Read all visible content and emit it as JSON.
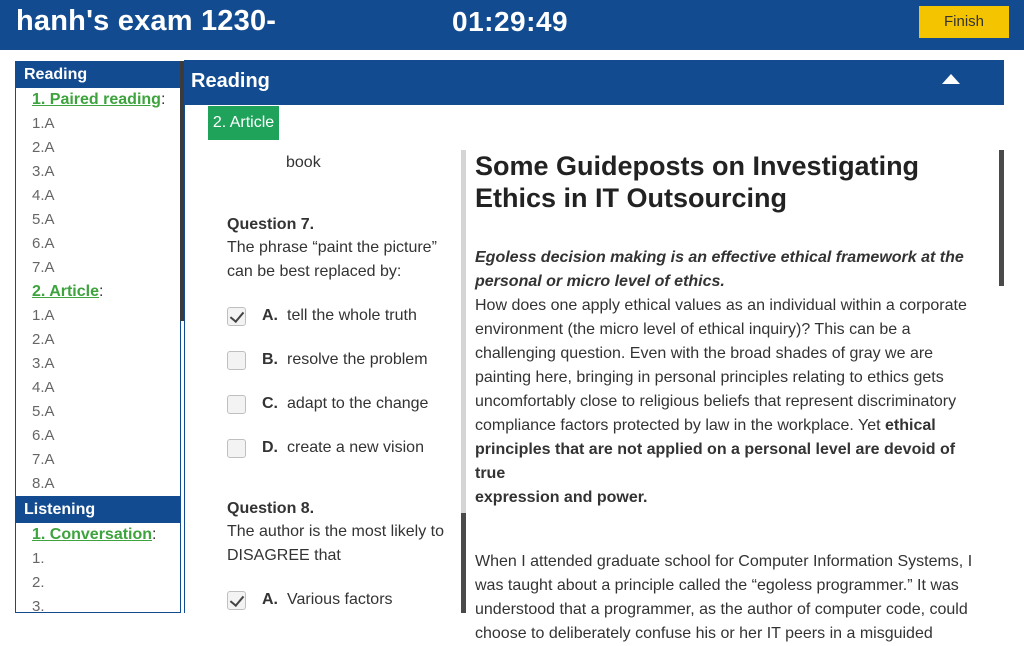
{
  "header": {
    "exam_title": "hanh's exam 1230-",
    "timer": "01:29:49",
    "finish_label": "Finish"
  },
  "sidebar": {
    "reading_heading": "Reading",
    "part1": {
      "label": "1. Paired reading",
      "items": [
        "1.A",
        "2.A",
        "3.A",
        "4.A",
        "5.A",
        "6.A",
        "7.A"
      ]
    },
    "part2": {
      "label": "2. Article",
      "items": [
        "1.A",
        "2.A",
        "3.A",
        "4.A",
        "5.A",
        "6.A",
        "7.A",
        "8.A"
      ]
    },
    "listening_heading": "Listening",
    "part3": {
      "label": "1. Conversation",
      "items": [
        "1.",
        "2.",
        "3."
      ]
    }
  },
  "panel": {
    "heading": "Reading",
    "active_tab": "2. Article"
  },
  "questions": {
    "fragment": "book",
    "q7": {
      "title": "Question 7.",
      "text_line1": "The phrase “paint the picture”",
      "text_line2": "can be best replaced by:",
      "options": [
        {
          "letter": "A.",
          "text": "tell the whole truth",
          "checked": true
        },
        {
          "letter": "B.",
          "text": "resolve the problem",
          "checked": false
        },
        {
          "letter": "C.",
          "text": "adapt to the change",
          "checked": false
        },
        {
          "letter": "D.",
          "text": "create a new vision",
          "checked": false
        }
      ]
    },
    "q8": {
      "title": "Question 8.",
      "text_line1": "The author is the most likely to",
      "text_line2": "DISAGREE that",
      "options": [
        {
          "letter": "A.",
          "text": "Various factors",
          "checked": true
        }
      ]
    }
  },
  "article": {
    "title_line1": "Some Guideposts on Investigating",
    "title_line2": "Ethics in IT Outsourcing",
    "lead_line1": "Egoless decision making is an effective ethical framework at the",
    "lead_line2": "personal or micro level of ethics.",
    "p1_lines": [
      "How does one apply ethical values as an individual within a corporate",
      "environment (the micro level of ethical inquiry)? This can be a",
      "challenging question. Even with the broad shades of gray we are",
      "painting here, bringing in personal principles relating to ethics gets",
      "uncomfortably close to religious beliefs that represent discriminatory"
    ],
    "p1_line6_plain": "compliance factors protected by law in the workplace. Yet ",
    "p1_line6_bold": "ethical",
    "p1_bold_lines": [
      "principles that are not applied on a personal level are devoid of true",
      "expression and power."
    ],
    "p2_lines": [
      "When I attended graduate school for Computer Information Systems, I",
      "was taught about a principle called the “egoless programmer.” It was",
      "understood that a programmer, as the author of computer code, could",
      "choose to deliberately confuse his or her IT peers in a misguided"
    ]
  }
}
